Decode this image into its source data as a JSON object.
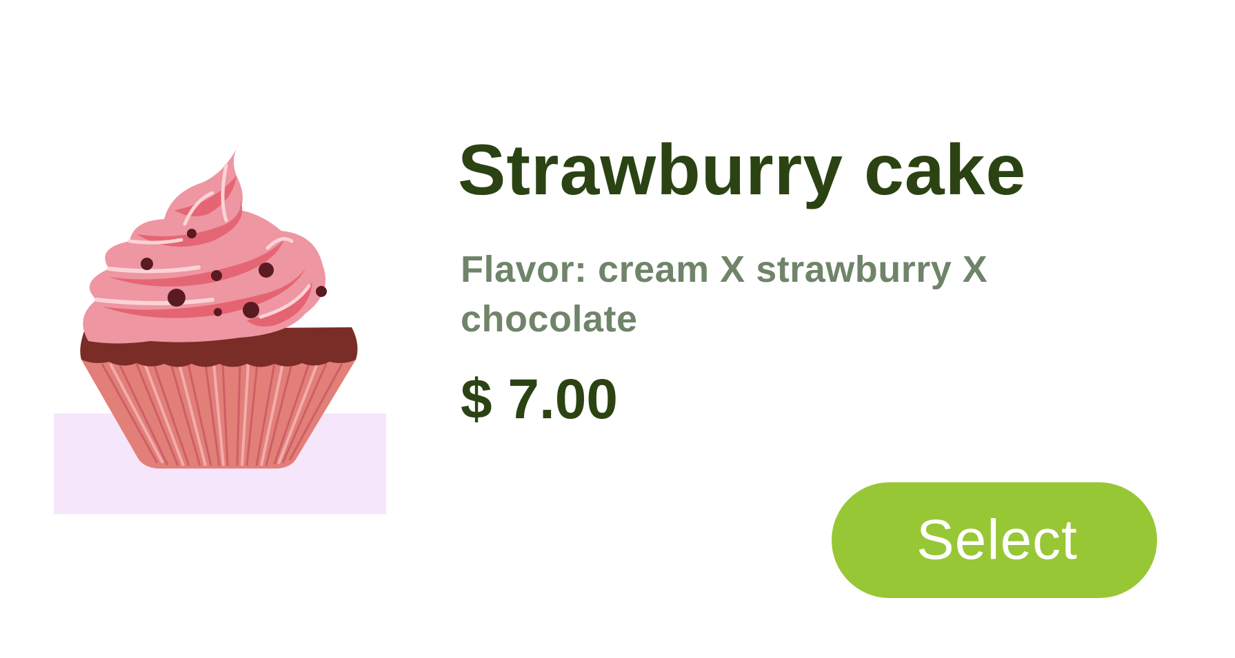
{
  "product": {
    "name": "Strawburry cake",
    "flavor_text": "Flavor: cream X  strawburry X chocolate",
    "price": "$ 7.00",
    "select_label": "Select",
    "image_icon": "cupcake-icon"
  },
  "colors": {
    "title": "#2b4313",
    "flavor": "#6f8469",
    "price": "#2b4313",
    "button_bg": "#98c735",
    "button_text": "#ffffff",
    "image_backdrop": "#f5e6fb",
    "frosting": "#ee96a2",
    "frosting_dark": "#e25e6c",
    "cake": "#7a2c26",
    "wrapper": "#e27f78"
  }
}
